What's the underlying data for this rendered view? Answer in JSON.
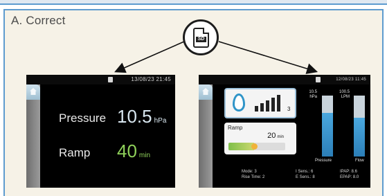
{
  "heading": "A. Correct",
  "sd_icon": {
    "name": "sd-card-icon",
    "label": "SD"
  },
  "screen_simple": {
    "status": "13/08/23  21:45",
    "pressure_label": "Pressure",
    "pressure_value": "10.5",
    "pressure_unit": "hPa",
    "ramp_label": "Ramp",
    "ramp_value": "40",
    "ramp_unit": "min",
    "colors": {
      "pressure": "#d9e7f0",
      "ramp": "#8fd15a"
    }
  },
  "screen_detailed": {
    "status": "12/08/23  11:45",
    "humidity_level": "3",
    "humidity_bars": 5,
    "ramp_label": "Ramp",
    "ramp_value": "20",
    "ramp_unit": "min",
    "ramp_progress": 0.45,
    "pressure_gauge": {
      "value": "10.5",
      "unit": "hPa",
      "label": "Pressure",
      "fill": 0.72
    },
    "flow_gauge": {
      "value": "100.5",
      "unit": "LPM",
      "label": "Flow",
      "fill": 0.64
    },
    "footer": {
      "mode": "Mode: 3",
      "rise_time": "Rise Time: 2",
      "i_sens": "I Sens.: 6",
      "e_sens": "E Sens.: 8",
      "ipap": "IPAP: 8.6",
      "epap": "EPAP: 8.0"
    }
  }
}
